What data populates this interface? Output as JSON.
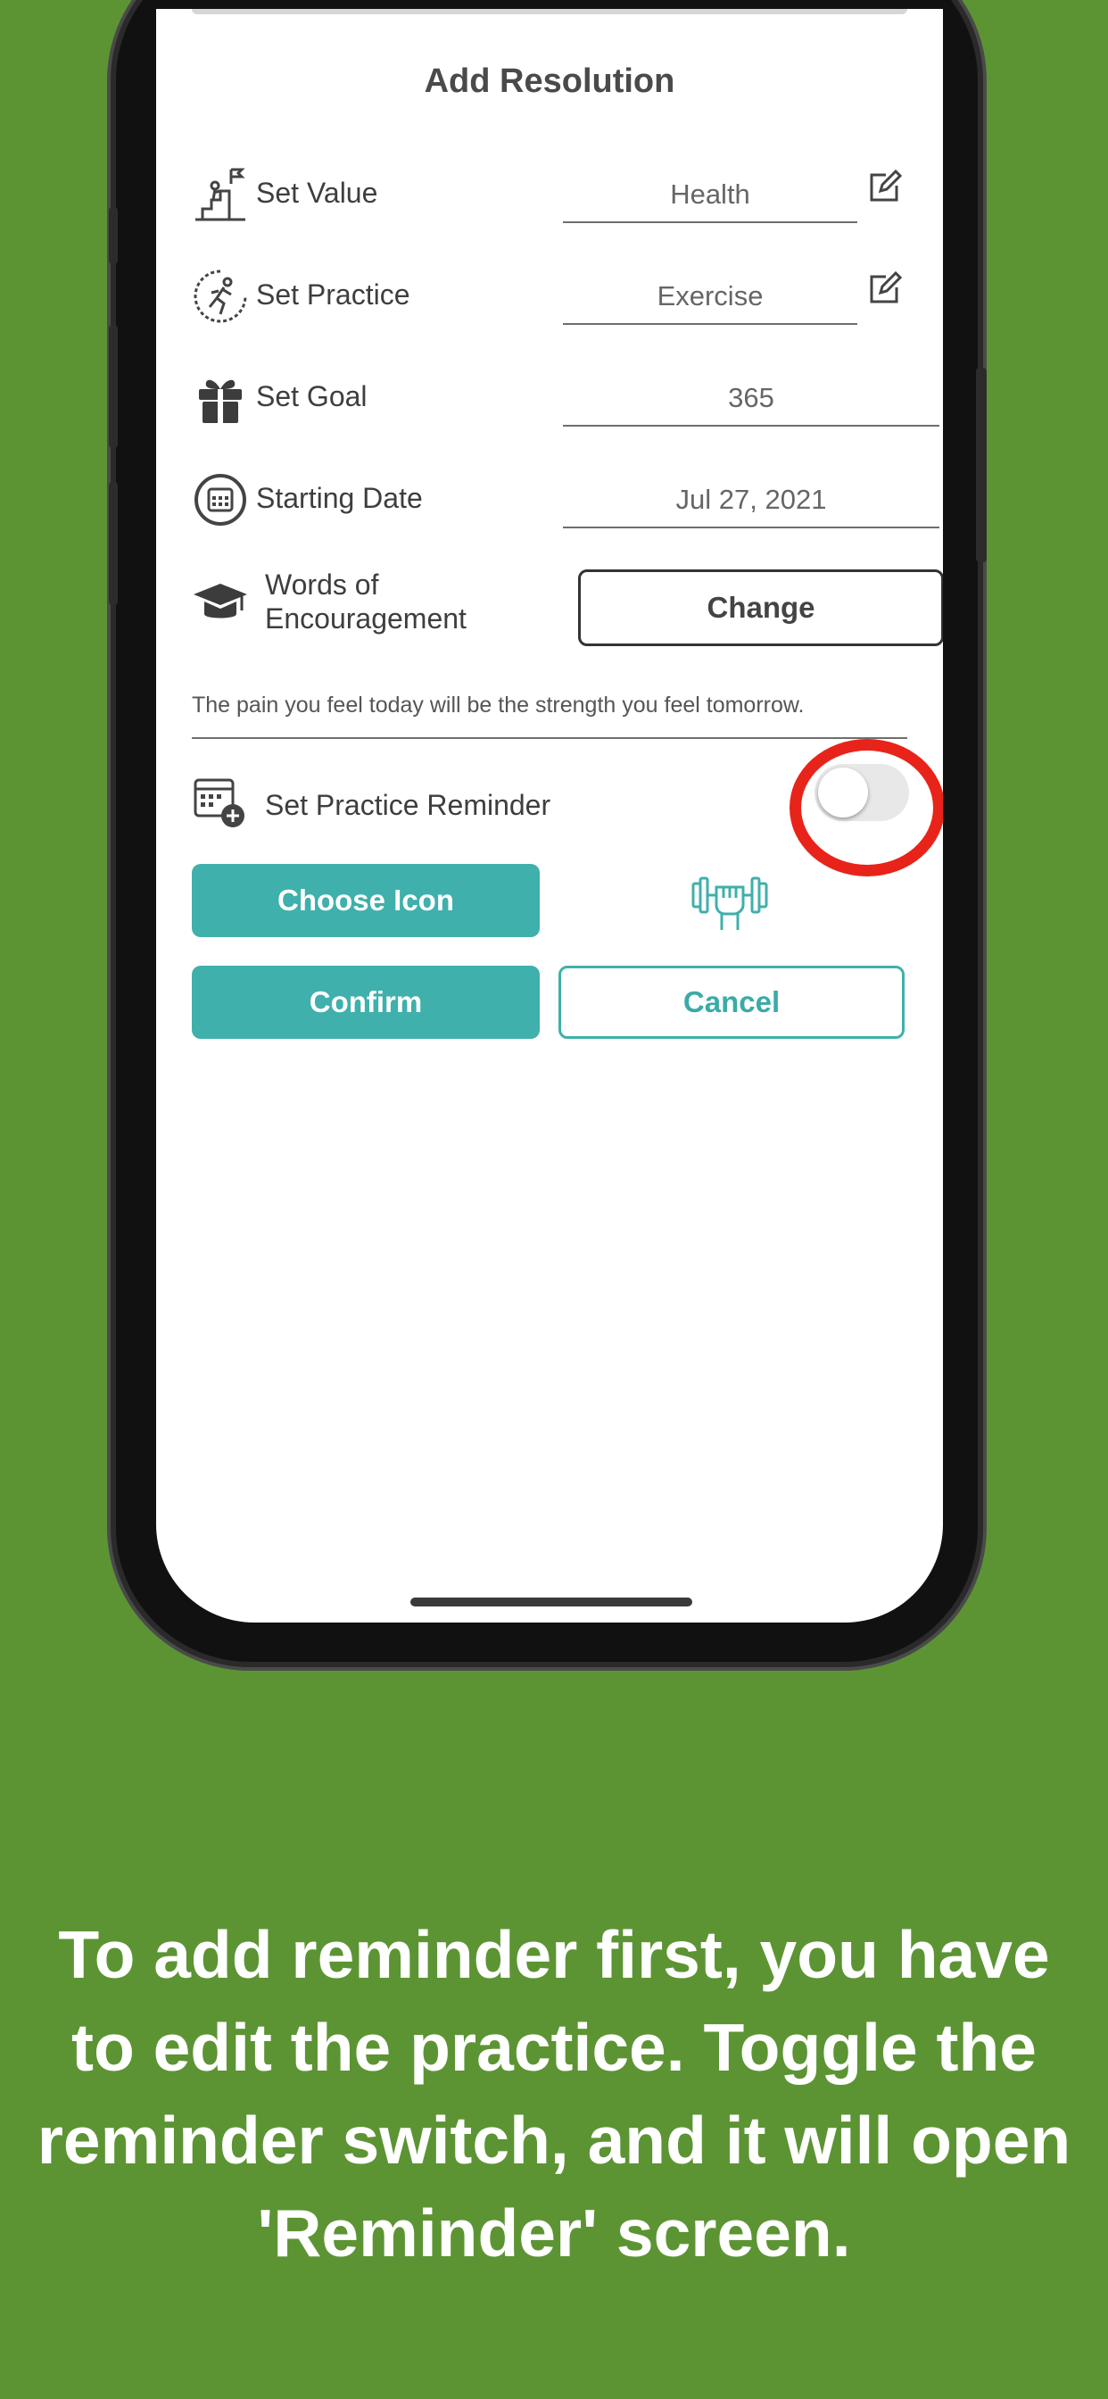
{
  "screen": {
    "title": "Add Resolution",
    "rows": [
      {
        "label": "Set Value",
        "value": "Health",
        "icon": "mountain-climber-icon",
        "editable": true
      },
      {
        "label": "Set Practice",
        "value": "Exercise",
        "icon": "runner-icon",
        "editable": true
      },
      {
        "label": "Set Goal",
        "value": "365",
        "icon": "gift-icon",
        "editable": false
      },
      {
        "label": "Starting Date",
        "value": "Jul 27, 2021",
        "icon": "calendar-circle-icon",
        "editable": false
      }
    ],
    "encouragement": {
      "label": "Words of Encouragement",
      "label_line1": "Words of",
      "label_line2": "Encouragement",
      "button": "Change",
      "icon": "graduation-cap-icon",
      "quote": "The pain you feel today will be the strength you feel tomorrow."
    },
    "reminder": {
      "label": "Set Practice Reminder",
      "icon": "calendar-plus-icon",
      "on": false
    },
    "choose_icon_button": "Choose Icon",
    "selected_icon": "dumbbell-fist-icon",
    "confirm_button": "Confirm",
    "cancel_button": "Cancel"
  },
  "caption": "To add reminder first, you have to edit the practice. Toggle the reminder switch, and it will open 'Reminder' screen.",
  "colors": {
    "background": "#5c9433",
    "teal": "#3fb0ab",
    "highlight": "#e8231a"
  }
}
